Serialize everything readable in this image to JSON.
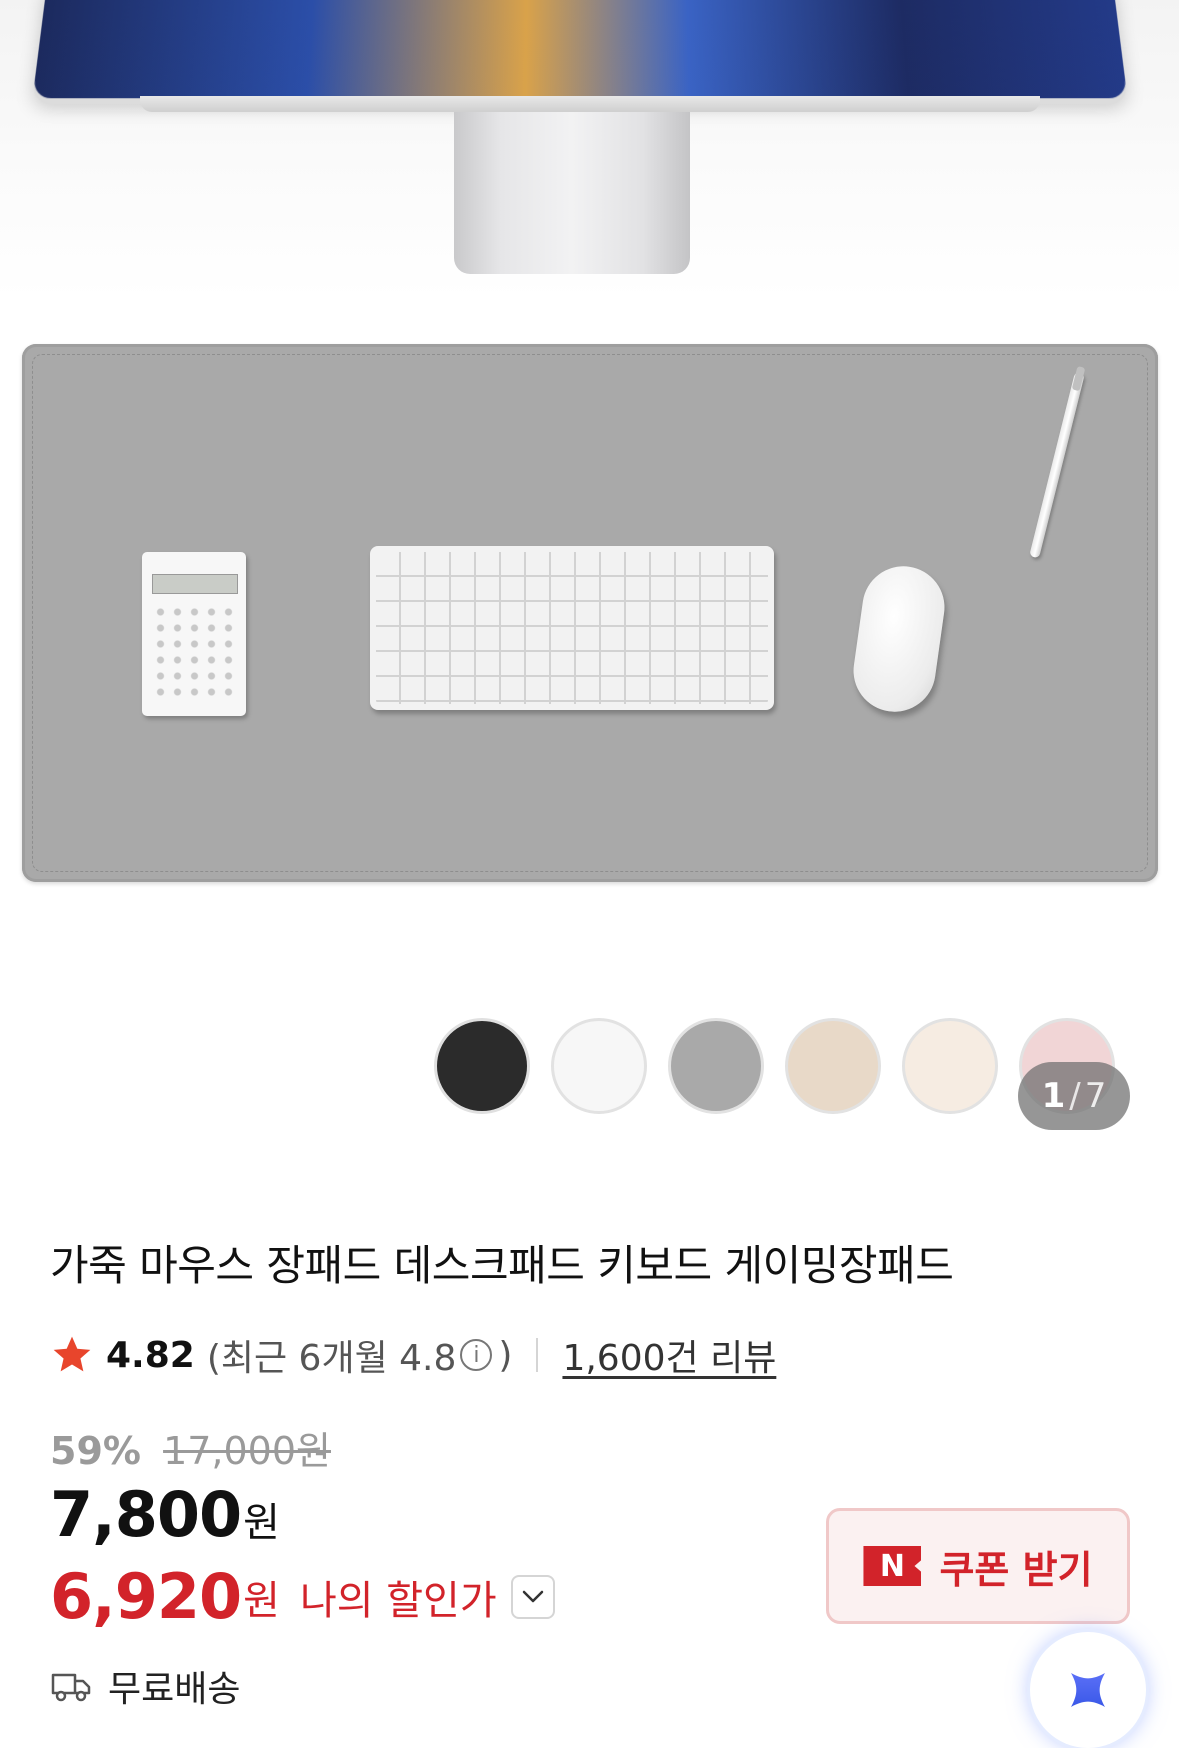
{
  "product_image": {
    "color_swatches": [
      {
        "name": "black",
        "color": "#2b2b2b"
      },
      {
        "name": "white",
        "color": "#f7f7f7"
      },
      {
        "name": "gray",
        "color": "#a9a9a9"
      },
      {
        "name": "beige",
        "color": "#e8d9c8"
      },
      {
        "name": "cream",
        "color": "#f6ece2"
      },
      {
        "name": "pink",
        "color": "#f1d5d6"
      }
    ],
    "counter": {
      "current": "1",
      "separator": "/",
      "total": "7"
    }
  },
  "product": {
    "title": "가죽 마우스 장패드 데스크패드 키보드 게이밍장패드",
    "rating": "4.82",
    "recent_rating_text": "(최근 6개월 4.8",
    "recent_rating_close": ")",
    "info_icon": "i",
    "review_count": "1,600건 리뷰"
  },
  "pricing": {
    "discount_percent": "59%",
    "original_price": "17,000원",
    "price": "7,800",
    "price_unit": "원",
    "my_price": "6,920",
    "my_price_unit": "원",
    "my_price_label": "나의 할인가"
  },
  "coupon": {
    "icon_text": "N",
    "label": "쿠폰 받기"
  },
  "shipping": {
    "label": "무료배송"
  },
  "colors": {
    "accent": "#d2232a",
    "star": "#e8452c"
  }
}
